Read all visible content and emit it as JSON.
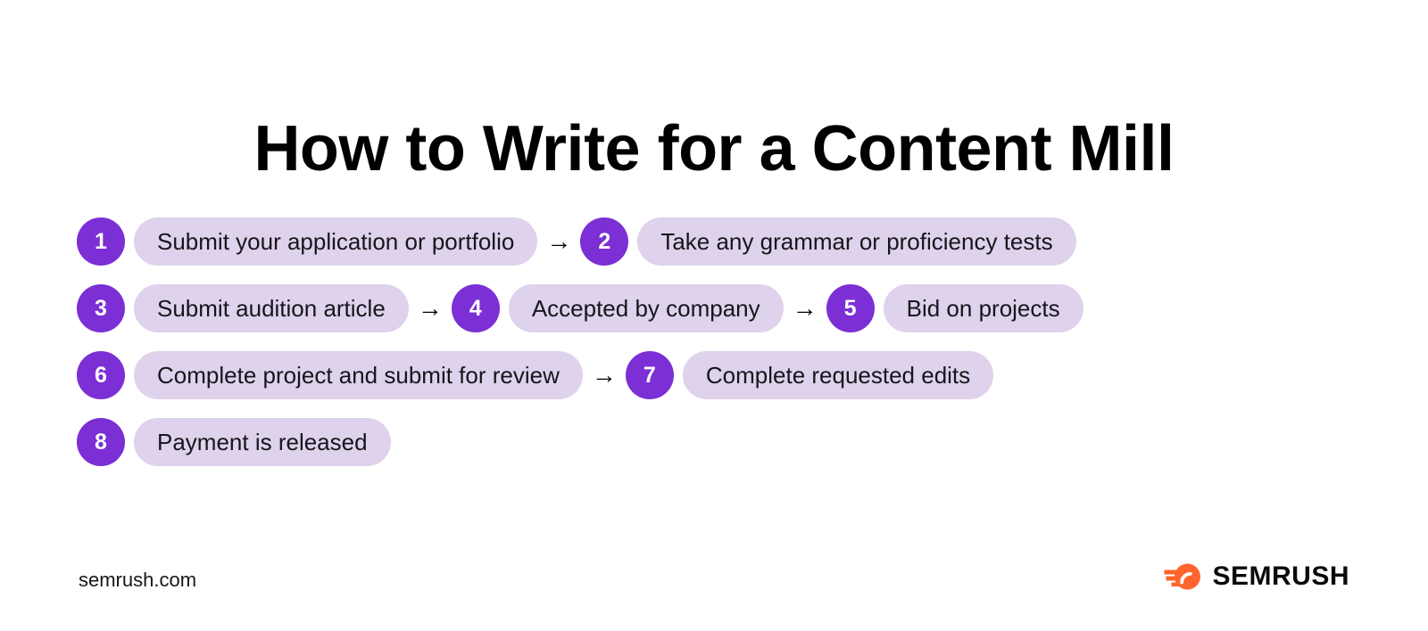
{
  "page": {
    "background_color": "#ffffff",
    "title": "How to Write for a Content Mill"
  },
  "theme": {
    "badge_color": "#7b2fd4",
    "badge_text_color": "#ffffff",
    "pill_color": "#ded2ec",
    "pill_text_color": "#16161c",
    "arrow_color": "#000000",
    "logo_accent_color": "#ff642d",
    "title_color": "#000000"
  },
  "flow": {
    "arrow_glyph": "→",
    "rows": [
      {
        "steps": [
          {
            "number": "1",
            "label": "Submit your application or portfolio",
            "arrow_after": true
          },
          {
            "number": "2",
            "label": "Take any grammar or proficiency tests",
            "arrow_after": false
          }
        ]
      },
      {
        "steps": [
          {
            "number": "3",
            "label": "Submit audition article",
            "arrow_after": true
          },
          {
            "number": "4",
            "label": "Accepted by company",
            "arrow_after": true
          },
          {
            "number": "5",
            "label": "Bid on projects",
            "arrow_after": false
          }
        ]
      },
      {
        "steps": [
          {
            "number": "6",
            "label": "Complete project and submit for review",
            "arrow_after": true
          },
          {
            "number": "7",
            "label": "Complete requested edits",
            "arrow_after": false
          }
        ]
      },
      {
        "steps": [
          {
            "number": "8",
            "label": "Payment is released",
            "arrow_after": false
          }
        ]
      }
    ]
  },
  "footer": {
    "url": "semrush.com",
    "brand_name": "SEMRUSH",
    "logo_icon": "semrush-comet-icon"
  }
}
